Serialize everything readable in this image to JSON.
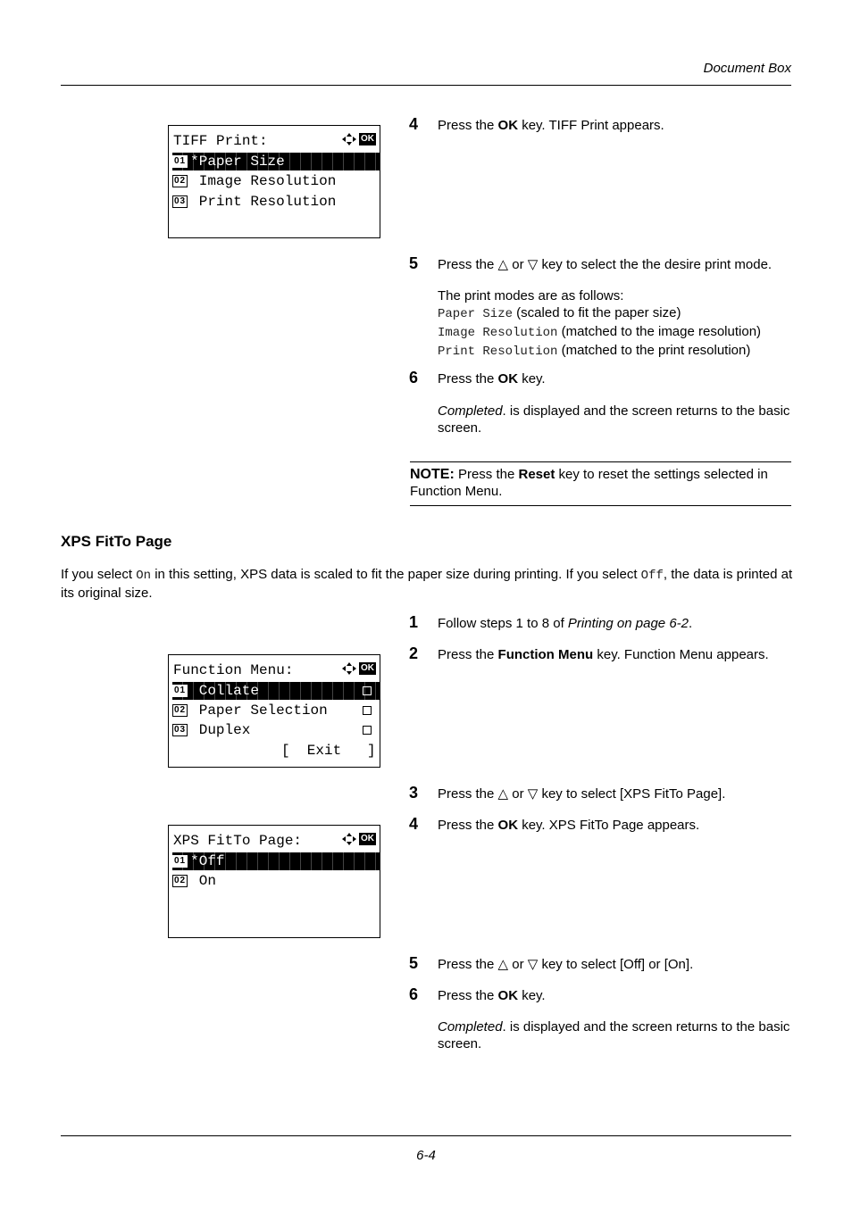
{
  "header": {
    "title": "Document Box"
  },
  "footer": {
    "page_number": "6-4"
  },
  "tiff_section": {
    "lcd": {
      "title": "TIFF Print:",
      "ok_label": "OK",
      "items": [
        {
          "num": "01",
          "label": "*Paper Size",
          "selected": true
        },
        {
          "num": "02",
          "label": " Image Resolution",
          "selected": false
        },
        {
          "num": "03",
          "label": " Print Resolution",
          "selected": false
        }
      ]
    },
    "steps": [
      {
        "num": "4",
        "pre": "Press the ",
        "bold": "OK",
        "post": " key. TIFF Print appears."
      },
      {
        "num": "5",
        "text": "Press the △ or ▽ key to select the the desire print mode.",
        "detail_intro": "The print modes are as follows:",
        "modes": [
          {
            "code": "Paper Size",
            "desc": " (scaled to fit the paper size)"
          },
          {
            "code": "Image Resolution",
            "desc": " (matched to the image resolution)"
          },
          {
            "code": "Print Resolution",
            "desc": " (matched to the print resolution)"
          }
        ]
      },
      {
        "num": "6",
        "pre": "Press the ",
        "bold": "OK",
        "post": " key.",
        "detail_italic": "Completed",
        "detail_rest": ". is displayed and the screen returns to the basic screen."
      }
    ],
    "note": {
      "label": "NOTE:",
      "pre": " Press the ",
      "bold": "Reset",
      "post": " key to reset the settings selected in Function Menu."
    }
  },
  "xps_section": {
    "title": "XPS FitTo Page",
    "intro": {
      "p1": "If you select ",
      "code1": "On",
      "p2": " in this setting, XPS data is scaled to fit the paper size during printing. If you select ",
      "code2": "Off",
      "p3": ", the data is printed at its original size."
    },
    "lcd_function_menu": {
      "title": "Function Menu:",
      "ok_label": "OK",
      "items": [
        {
          "num": "01",
          "label": " Collate",
          "selected": true
        },
        {
          "num": "02",
          "label": " Paper Selection",
          "selected": false
        },
        {
          "num": "03",
          "label": " Duplex",
          "selected": false
        }
      ],
      "exit_label": "[  Exit   ]"
    },
    "lcd_xps": {
      "title": "XPS FitTo Page:",
      "ok_label": "OK",
      "items": [
        {
          "num": "01",
          "label": "*Off",
          "selected": true
        },
        {
          "num": "02",
          "label": " On",
          "selected": false
        }
      ]
    },
    "steps": [
      {
        "num": "1",
        "pre": "Follow steps 1 to 8 of ",
        "italic": "Printing on page 6-2",
        "post": "."
      },
      {
        "num": "2",
        "pre": "Press the ",
        "bold": "Function Menu",
        "post": " key. Function Menu appears."
      },
      {
        "num": "3",
        "text": "Press the △ or ▽ key to select [XPS FitTo Page]."
      },
      {
        "num": "4",
        "pre": "Press the ",
        "bold": "OK",
        "post": " key. XPS FitTo Page appears."
      },
      {
        "num": "5",
        "text": "Press the △ or ▽ key to select [Off] or [On]."
      },
      {
        "num": "6",
        "pre": "Press the ",
        "bold": "OK",
        "post": " key.",
        "detail_italic": "Completed",
        "detail_rest": ". is displayed and the screen returns to the basic screen."
      }
    ]
  }
}
